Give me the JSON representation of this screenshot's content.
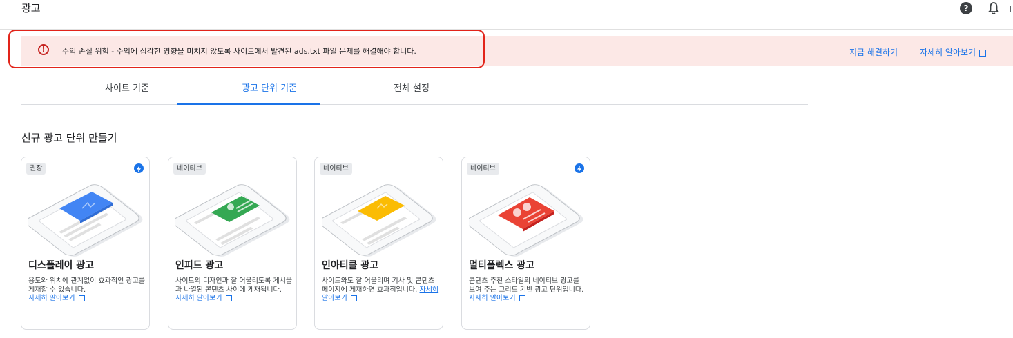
{
  "header": {
    "title": "광고"
  },
  "alert": {
    "message": "수익 손실 위험 - 수익에 심각한 영향을 미치지 않도록 사이트에서 발견된 ads.txt 파일 문제를 해결해야 합니다.",
    "fix_label": "지금 해결하기",
    "learn_label": "자세히 알아보기"
  },
  "tabs": [
    {
      "label": "사이트 기준"
    },
    {
      "label": "광고 단위 기준"
    },
    {
      "label": "전체 설정"
    }
  ],
  "section": {
    "title": "신규 광고 단위 만들기"
  },
  "cards": [
    {
      "badge": "권장",
      "title": "디스플레이 광고",
      "desc": "용도와 위치에 관계없이 효과적인 광고를 게재할 수 있습니다.",
      "link": "자세히 알아보기",
      "accent": "#4285f4"
    },
    {
      "badge": "네이티브",
      "title": "인피드 광고",
      "desc": "사이트의 디자인과 잘 어울리도록 게시물과 나열된 콘텐츠 사이에 게재됩니다.",
      "link": "자세히 알아보기",
      "accent": "#34a853"
    },
    {
      "badge": "네이티브",
      "title": "인아티클 광고",
      "desc": "사이트와도 잘 어울리며 기사 및 콘텐츠 페이지에 게재하면 효과적입니다.",
      "link": "자세히 알아보기",
      "accent": "#fbbc04"
    },
    {
      "badge": "네이티브",
      "title": "멀티플렉스 광고",
      "desc": "콘텐츠 추천 스타일의 네이티브 광고를 보여 주는 그리드 기반 광고 단위입니다.",
      "link": "자세히 알아보기",
      "accent": "#ea4335"
    }
  ]
}
